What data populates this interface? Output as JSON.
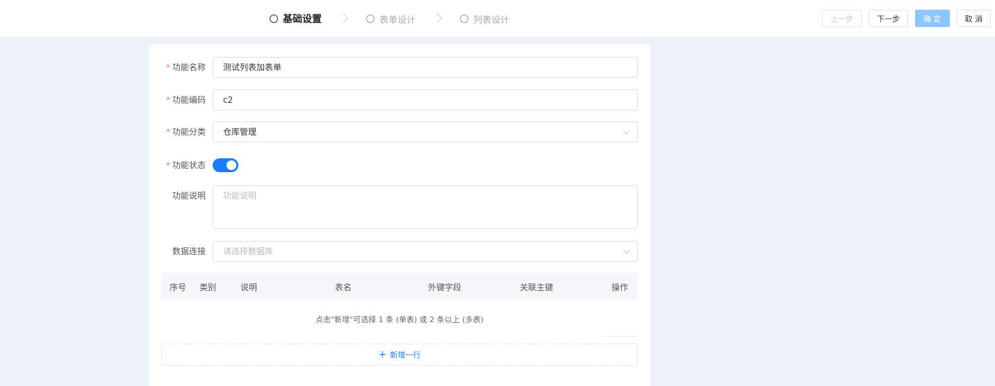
{
  "steps": [
    {
      "label": "基础设置"
    },
    {
      "label": "表单设计"
    },
    {
      "label": "列表设计"
    }
  ],
  "actions": {
    "prev": "上一步",
    "next": "下一步",
    "confirm": "确 定",
    "cancel": "取 消"
  },
  "form": {
    "name": {
      "label": "功能名称",
      "value": "测试列表加表单"
    },
    "code": {
      "label": "功能编码",
      "value": "c2"
    },
    "category": {
      "label": "功能分类",
      "value": "仓库管理"
    },
    "status": {
      "label": "功能状态",
      "on": true
    },
    "desc": {
      "label": "功能说明",
      "placeholder": "功能说明"
    },
    "db": {
      "label": "数据连接",
      "placeholder": "请选择数据库"
    }
  },
  "table": {
    "columns": [
      "序号",
      "类别",
      "说明",
      "表名",
      "外键字段",
      "关联主键",
      "操作"
    ],
    "empty_text": "点击\"新增\"可选择 1 条 (单表) 或 2 条以上 (多表)",
    "add_label": "新增一行"
  },
  "colors": {
    "accent": "#1a7cff",
    "required": "#f56c6c"
  }
}
